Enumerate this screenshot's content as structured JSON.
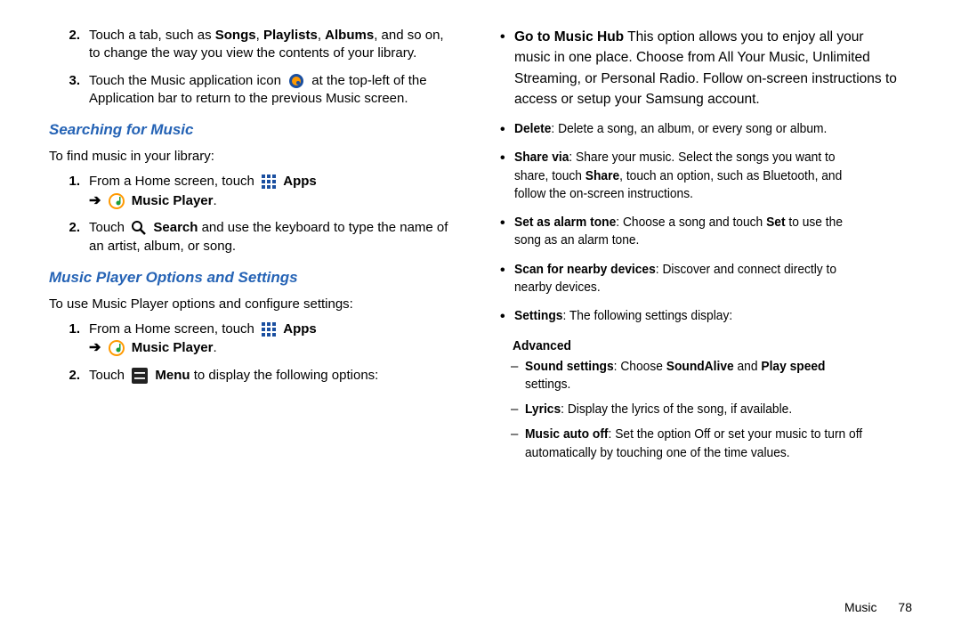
{
  "left": {
    "step2_pre": "Touch a tab, such as ",
    "step2_b1": "Songs",
    "step2_b2": "Playlists",
    "step2_b3": "Albums",
    "step2_post": ", and so on, to change the way you view the contents of your library.",
    "step3_pre": "Touch the Music application icon ",
    "step3_post": " at the top-left of the Application bar to return to the previous Music screen.",
    "heading_search": "Searching for Music",
    "search_intro": "To find music in your library:",
    "s_step1_pre": "From a Home screen, touch ",
    "apps_label": "Apps",
    "arrow": "➔",
    "music_player_label": "Music Player",
    "s_step2_pre": "Touch ",
    "s_step2_b": "Search",
    "s_step2_post": " and use the keyboard to type the name of an artist, album, or song.",
    "heading_opts": "Music Player Options and Settings",
    "opts_intro": "To use Music Player options and configure settings:",
    "o_step2_pre": "Touch ",
    "o_step2_b": "Menu",
    "o_step2_post": " to display the following options:"
  },
  "right": {
    "hub_b": "Go to Music Hub",
    "hub_t": "  This option allows you to enjoy all your music in one place. Choose from All Your Music, Unlimited Streaming, or Personal Radio. Follow on-screen instructions to access or setup your Samsung account.",
    "del_b": "Delete",
    "del_t": ": Delete a song, an album, or every song or album.",
    "share_b": "Share via",
    "share_t1": ": Share your music. Select the songs you want to share, touch ",
    "share_b2": "Share",
    "share_t2": ", touch an option, such as Bluetooth, and follow the on-screen instructions.",
    "alarm_b": "Set as alarm tone",
    "alarm_t1": ": Choose a song and touch ",
    "alarm_b2": "Set",
    "alarm_t2": " to use the song as an alarm tone.",
    "scan_b": "Scan for nearby devices",
    "scan_t": ": Discover and connect directly to nearby devices.",
    "settings_b": "Settings",
    "settings_t": ": The following settings display:",
    "adv": "Advanced",
    "ss_b": "Sound settings",
    "ss_t1": ": Choose ",
    "ss_b2": "SoundAlive",
    "ss_t2": " and ",
    "ss_b3": "Play speed",
    "ss_t3": " settings.",
    "lyr_b": "Lyrics",
    "lyr_t": ": Display the lyrics of the song, if available.",
    "mao_b": "Music auto off",
    "mao_t": ": Set the option Off or set your music to turn off automatically by touching one of the time values."
  },
  "footer": {
    "section": "Music",
    "page": "78"
  },
  "nums": {
    "n1": "1.",
    "n2": "2.",
    "n3": "3."
  }
}
